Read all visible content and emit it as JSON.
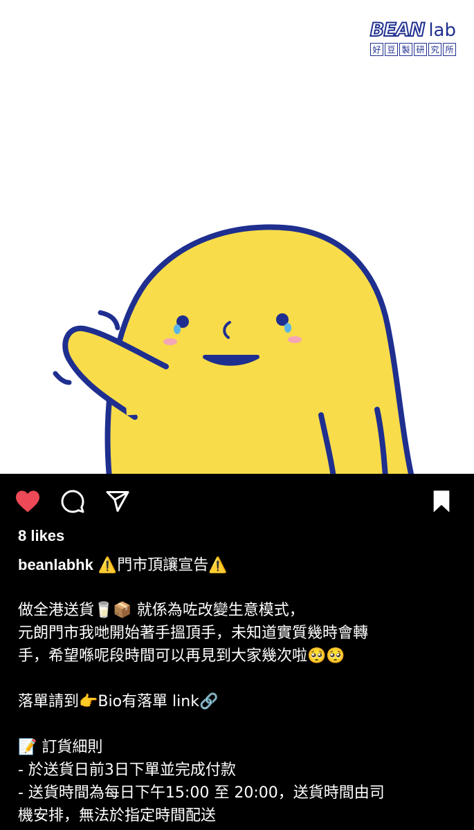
{
  "post": {
    "logo": {
      "brand": "BEAN",
      "sub": "lab",
      "chinese": [
        "好",
        "豆",
        "製",
        "研",
        "究",
        "所"
      ]
    },
    "mascot": "yellow-bean-mascot-waving-crying"
  },
  "actions": {
    "like_icon": "heart-filled-icon",
    "comment_icon": "comment-icon",
    "share_icon": "send-icon",
    "save_icon": "bookmark-icon",
    "like_color": "#ED4956"
  },
  "likes": "8 likes",
  "caption": {
    "username": "beanlabhk",
    "title": " ⚠️門市頂讓宣告⚠️",
    "lines": [
      "做全港送貨🥛📦 就係為咗改變生意模式，",
      "元朗門市我哋開始著手搵頂手，未知道實質幾時會轉",
      "手，希望喺呢段時間可以再見到大家幾次啦🥺🥺",
      "",
      "落單請到👉Bio有落單 link🔗",
      "",
      "📝 訂貨細則",
      "- 於送貨日前3日下單並完成付款",
      "- 送貨時間為每日下午15:00 至 20:00，送貨時間由司",
      "機安排，無法於指定時間配送"
    ]
  }
}
